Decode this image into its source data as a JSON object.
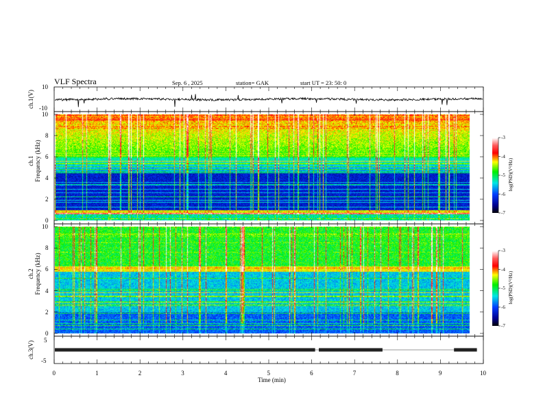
{
  "header": {
    "title": "VLF  Spectra",
    "date": "Sep. 6  , 2025",
    "station": "station= GAK",
    "start": "start  UT  =    23: 50: 0"
  },
  "colors": {
    "trace": "#000000",
    "axis": "#000000"
  },
  "chart_data": [
    {
      "type": "line",
      "name": "ch1-waveform",
      "ylabel": "ch.1(V)",
      "ylim": [
        -10,
        10
      ],
      "yticks": [
        "10",
        "-10"
      ],
      "xlim": [
        0,
        10
      ],
      "baseline": 0
    },
    {
      "type": "heatmap",
      "name": "ch1-spectrogram",
      "ylabel": "ch.1\nFrequency  (kHz)",
      "ylabel_lines": [
        "ch.1",
        "Frequency  (kHz)"
      ],
      "ylim": [
        0,
        10
      ],
      "yticks": [
        "0",
        "2",
        "4",
        "6",
        "8",
        "10"
      ],
      "xlim": [
        0,
        10
      ],
      "data_end_min": 9.85,
      "colorbar": {
        "label": "log(PSD)(V²/Hz)",
        "range": [
          -7,
          -3
        ],
        "ticks": [
          "-3",
          "-4",
          "-5",
          "-6",
          "-7"
        ]
      }
    },
    {
      "type": "heatmap",
      "name": "ch2-spectrogram",
      "ylabel_lines": [
        "ch.2",
        "Frequency  (kHz)"
      ],
      "ylim": [
        0,
        10
      ],
      "yticks": [
        "0",
        "2",
        "4",
        "6",
        "8",
        "10"
      ],
      "xlim": [
        0,
        10
      ],
      "data_end_min": 9.85,
      "colorbar": {
        "label": "log(PSD)(V²/Hz)",
        "range": [
          -7,
          -3
        ],
        "ticks": [
          "-3",
          "-4",
          "-5",
          "-6",
          "-7"
        ]
      }
    },
    {
      "type": "line",
      "name": "ch3-waveform",
      "ylabel": "ch.3(V)",
      "ylim": [
        -5,
        5
      ],
      "yticks": [
        "5",
        "-5"
      ],
      "xlim": [
        0,
        10
      ],
      "level": 0,
      "gaps_min": [
        [
          6.08,
          6.15
        ],
        [
          7.65,
          9.3
        ]
      ]
    }
  ],
  "xaxis": {
    "label": "Time  (min)",
    "ticks": [
      "0",
      "1",
      "2",
      "3",
      "4",
      "5",
      "6",
      "7",
      "8",
      "9",
      "10"
    ]
  }
}
